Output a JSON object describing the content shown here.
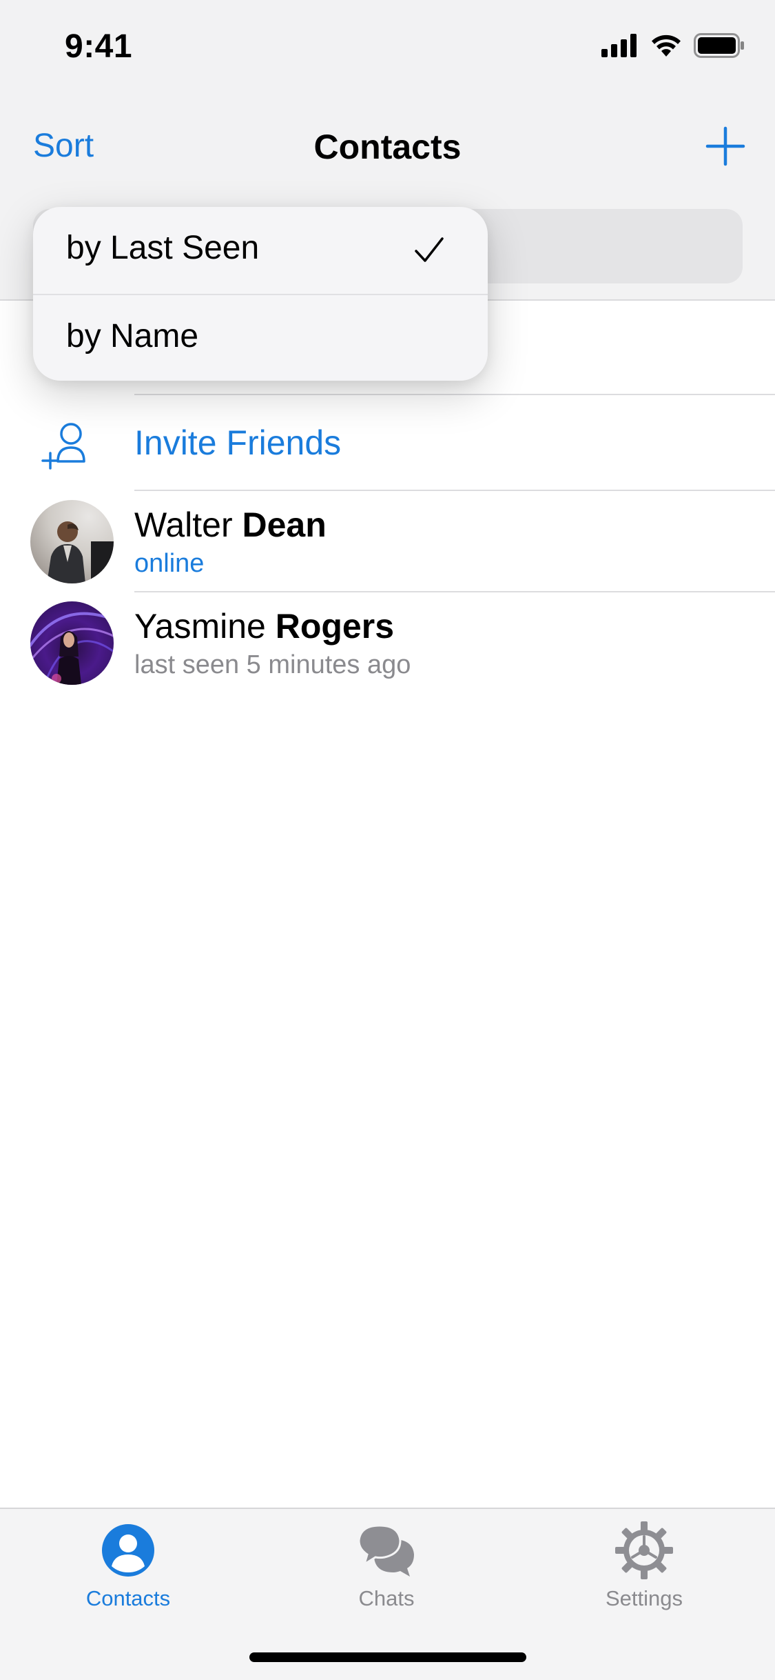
{
  "status_bar": {
    "time": "9:41"
  },
  "nav": {
    "sort_label": "Sort",
    "title": "Contacts",
    "add_icon": "plus-icon"
  },
  "sort_menu": {
    "items": [
      {
        "label": "by Last Seen",
        "selected": true
      },
      {
        "label": "by Name",
        "selected": false
      }
    ]
  },
  "list": {
    "invite_label": "Invite Friends",
    "contacts": [
      {
        "first": "Walter",
        "last": "Dean",
        "status": "online",
        "status_type": "online"
      },
      {
        "first": "Yasmine",
        "last": "Rogers",
        "status": "last seen 5 minutes ago",
        "status_type": "seen"
      }
    ]
  },
  "tab_bar": {
    "tabs": [
      {
        "label": "Contacts",
        "icon": "person-circle-icon",
        "active": true
      },
      {
        "label": "Chats",
        "icon": "chat-bubbles-icon",
        "active": false
      },
      {
        "label": "Settings",
        "icon": "gear-icon",
        "active": false
      }
    ]
  },
  "colors": {
    "accent": "#1a7cdc",
    "secondary_text": "#8a8a8e",
    "header_bg": "#f2f2f3"
  }
}
